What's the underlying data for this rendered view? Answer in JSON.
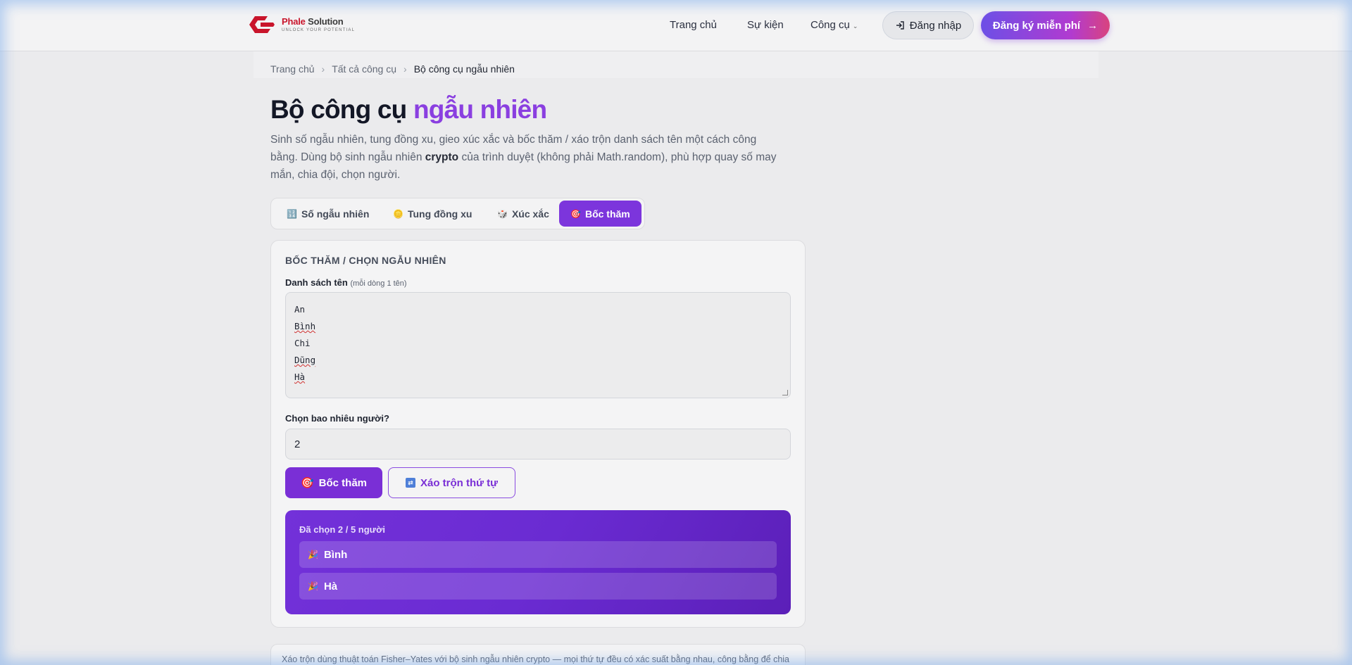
{
  "header": {
    "brand_name": "Phale",
    "brand_suffix": "Solution",
    "brand_tagline": "UNLOCK YOUR POTENTIAL",
    "nav": [
      "Trang chủ",
      "Sự kiện",
      "Công cụ"
    ],
    "login_label": "Đăng nhập",
    "signup_label": "Đăng ký miễn phí"
  },
  "breadcrumb": [
    "Trang chủ",
    "Tất cả công cụ",
    "Bộ công cụ ngẫu nhiên"
  ],
  "page": {
    "title_main": "Bộ công cụ",
    "title_accent": "ngẫu nhiên",
    "desc_before": "Sinh số ngẫu nhiên, tung đồng xu, gieo xúc xắc và bốc thăm / xáo trộn danh sách tên một cách công bằng. Dùng bộ sinh ngẫu nhiên",
    "desc_bold": "crypto",
    "desc_after": "của trình duyệt (không phải Math.random), phù hợp quay số may mắn, chia đội, chọn người."
  },
  "tabs": [
    {
      "label": "Số ngẫu nhiên",
      "icon": "🔢",
      "active": false
    },
    {
      "label": "Tung đồng xu",
      "icon": "🪙",
      "active": false
    },
    {
      "label": "Xúc xắc",
      "icon": "🎲",
      "active": false
    },
    {
      "label": "Bốc thăm",
      "icon": "🎯",
      "active": true
    }
  ],
  "card": {
    "title": "BỐC THĂM / CHỌN NGẪU NHIÊN",
    "names_label": "Danh sách tên",
    "names_hint": "(mỗi dòng 1 tên)",
    "names": [
      "An",
      "Bình",
      "Chi",
      "Dũng",
      "Hà"
    ],
    "count_label": "Chọn bao nhiêu người?",
    "count_value": "2",
    "draw_button": "Bốc thăm",
    "shuffle_button": "Xáo trộn thứ tự",
    "result_heading": "Đã chọn 2 / 5 người",
    "results": [
      "Bình",
      "Hà"
    ]
  },
  "note": "Xáo trộn dùng thuật toán Fisher–Yates với bộ sinh ngẫu nhiên crypto — mọi thứ tự đều có xác suất bằng nhau, công bằng để chia",
  "colors": {
    "accent": "#7c35dc",
    "brand_red": "#c9152b"
  }
}
